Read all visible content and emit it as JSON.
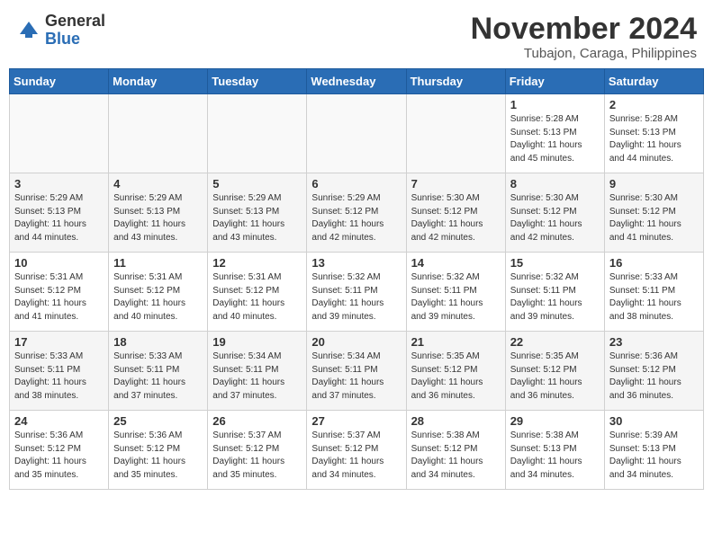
{
  "header": {
    "logo_general": "General",
    "logo_blue": "Blue",
    "month_title": "November 2024",
    "location": "Tubajon, Caraga, Philippines"
  },
  "days_of_week": [
    "Sunday",
    "Monday",
    "Tuesday",
    "Wednesday",
    "Thursday",
    "Friday",
    "Saturday"
  ],
  "weeks": [
    [
      {
        "day": "",
        "info": ""
      },
      {
        "day": "",
        "info": ""
      },
      {
        "day": "",
        "info": ""
      },
      {
        "day": "",
        "info": ""
      },
      {
        "day": "",
        "info": ""
      },
      {
        "day": "1",
        "info": "Sunrise: 5:28 AM\nSunset: 5:13 PM\nDaylight: 11 hours\nand 45 minutes."
      },
      {
        "day": "2",
        "info": "Sunrise: 5:28 AM\nSunset: 5:13 PM\nDaylight: 11 hours\nand 44 minutes."
      }
    ],
    [
      {
        "day": "3",
        "info": "Sunrise: 5:29 AM\nSunset: 5:13 PM\nDaylight: 11 hours\nand 44 minutes."
      },
      {
        "day": "4",
        "info": "Sunrise: 5:29 AM\nSunset: 5:13 PM\nDaylight: 11 hours\nand 43 minutes."
      },
      {
        "day": "5",
        "info": "Sunrise: 5:29 AM\nSunset: 5:13 PM\nDaylight: 11 hours\nand 43 minutes."
      },
      {
        "day": "6",
        "info": "Sunrise: 5:29 AM\nSunset: 5:12 PM\nDaylight: 11 hours\nand 42 minutes."
      },
      {
        "day": "7",
        "info": "Sunrise: 5:30 AM\nSunset: 5:12 PM\nDaylight: 11 hours\nand 42 minutes."
      },
      {
        "day": "8",
        "info": "Sunrise: 5:30 AM\nSunset: 5:12 PM\nDaylight: 11 hours\nand 42 minutes."
      },
      {
        "day": "9",
        "info": "Sunrise: 5:30 AM\nSunset: 5:12 PM\nDaylight: 11 hours\nand 41 minutes."
      }
    ],
    [
      {
        "day": "10",
        "info": "Sunrise: 5:31 AM\nSunset: 5:12 PM\nDaylight: 11 hours\nand 41 minutes."
      },
      {
        "day": "11",
        "info": "Sunrise: 5:31 AM\nSunset: 5:12 PM\nDaylight: 11 hours\nand 40 minutes."
      },
      {
        "day": "12",
        "info": "Sunrise: 5:31 AM\nSunset: 5:12 PM\nDaylight: 11 hours\nand 40 minutes."
      },
      {
        "day": "13",
        "info": "Sunrise: 5:32 AM\nSunset: 5:11 PM\nDaylight: 11 hours\nand 39 minutes."
      },
      {
        "day": "14",
        "info": "Sunrise: 5:32 AM\nSunset: 5:11 PM\nDaylight: 11 hours\nand 39 minutes."
      },
      {
        "day": "15",
        "info": "Sunrise: 5:32 AM\nSunset: 5:11 PM\nDaylight: 11 hours\nand 39 minutes."
      },
      {
        "day": "16",
        "info": "Sunrise: 5:33 AM\nSunset: 5:11 PM\nDaylight: 11 hours\nand 38 minutes."
      }
    ],
    [
      {
        "day": "17",
        "info": "Sunrise: 5:33 AM\nSunset: 5:11 PM\nDaylight: 11 hours\nand 38 minutes."
      },
      {
        "day": "18",
        "info": "Sunrise: 5:33 AM\nSunset: 5:11 PM\nDaylight: 11 hours\nand 37 minutes."
      },
      {
        "day": "19",
        "info": "Sunrise: 5:34 AM\nSunset: 5:11 PM\nDaylight: 11 hours\nand 37 minutes."
      },
      {
        "day": "20",
        "info": "Sunrise: 5:34 AM\nSunset: 5:11 PM\nDaylight: 11 hours\nand 37 minutes."
      },
      {
        "day": "21",
        "info": "Sunrise: 5:35 AM\nSunset: 5:12 PM\nDaylight: 11 hours\nand 36 minutes."
      },
      {
        "day": "22",
        "info": "Sunrise: 5:35 AM\nSunset: 5:12 PM\nDaylight: 11 hours\nand 36 minutes."
      },
      {
        "day": "23",
        "info": "Sunrise: 5:36 AM\nSunset: 5:12 PM\nDaylight: 11 hours\nand 36 minutes."
      }
    ],
    [
      {
        "day": "24",
        "info": "Sunrise: 5:36 AM\nSunset: 5:12 PM\nDaylight: 11 hours\nand 35 minutes."
      },
      {
        "day": "25",
        "info": "Sunrise: 5:36 AM\nSunset: 5:12 PM\nDaylight: 11 hours\nand 35 minutes."
      },
      {
        "day": "26",
        "info": "Sunrise: 5:37 AM\nSunset: 5:12 PM\nDaylight: 11 hours\nand 35 minutes."
      },
      {
        "day": "27",
        "info": "Sunrise: 5:37 AM\nSunset: 5:12 PM\nDaylight: 11 hours\nand 34 minutes."
      },
      {
        "day": "28",
        "info": "Sunrise: 5:38 AM\nSunset: 5:12 PM\nDaylight: 11 hours\nand 34 minutes."
      },
      {
        "day": "29",
        "info": "Sunrise: 5:38 AM\nSunset: 5:13 PM\nDaylight: 11 hours\nand 34 minutes."
      },
      {
        "day": "30",
        "info": "Sunrise: 5:39 AM\nSunset: 5:13 PM\nDaylight: 11 hours\nand 34 minutes."
      }
    ]
  ]
}
